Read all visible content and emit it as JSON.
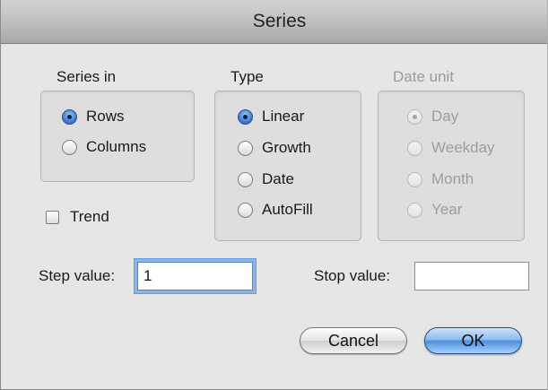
{
  "window": {
    "title": "Series"
  },
  "series_in": {
    "label": "Series in",
    "options": [
      {
        "label": "Rows",
        "checked": true
      },
      {
        "label": "Columns",
        "checked": false
      }
    ]
  },
  "type": {
    "label": "Type",
    "options": [
      {
        "label": "Linear",
        "checked": true
      },
      {
        "label": "Growth",
        "checked": false
      },
      {
        "label": "Date",
        "checked": false
      },
      {
        "label": "AutoFill",
        "checked": false
      }
    ]
  },
  "date_unit": {
    "label": "Date unit",
    "enabled": false,
    "options": [
      {
        "label": "Day",
        "checked": true
      },
      {
        "label": "Weekday",
        "checked": false
      },
      {
        "label": "Month",
        "checked": false
      },
      {
        "label": "Year",
        "checked": false
      }
    ]
  },
  "trend": {
    "label": "Trend",
    "checked": false
  },
  "step": {
    "label": "Step value:",
    "value": "1"
  },
  "stop": {
    "label": "Stop value:",
    "value": ""
  },
  "buttons": {
    "cancel": "Cancel",
    "ok": "OK"
  }
}
